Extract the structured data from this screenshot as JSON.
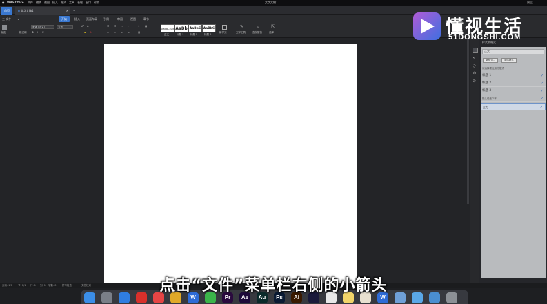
{
  "menubar": {
    "app_name": "WPS Office",
    "items": [
      "文件",
      "编辑",
      "视图",
      "插入",
      "格式",
      "工具",
      "表格",
      "窗口",
      "帮助"
    ],
    "window_title": "文字文稿1",
    "right_text": "周三"
  },
  "tabs": {
    "home_label": "首页",
    "doc_label": "文字文稿1",
    "add_icon": "plus-icon",
    "close_icon": "close-icon"
  },
  "ribbon": {
    "file_menu": "三 文件",
    "tabs": [
      "开始",
      "插入",
      "页面布局",
      "引用",
      "审阅",
      "视图",
      "章节"
    ],
    "active_tab": "开始"
  },
  "toolbar": {
    "paste_label": "粘贴",
    "format_painter_label": "格式刷",
    "font_name": "宋体 (正文)",
    "font_size": "五号",
    "styles": [
      {
        "preview": "AaBbCcDd",
        "caption": "正文"
      },
      {
        "preview": "AaBb",
        "caption": "标题 1"
      },
      {
        "preview": "AaBbC",
        "caption": "标题 2"
      },
      {
        "preview": "AaBbC",
        "caption": "标题 3"
      }
    ],
    "new_style_label": "新样式",
    "text_tools_label": "文字工具",
    "find_replace_label": "查找替换",
    "select_label": "选择"
  },
  "panel": {
    "title": "样式和格式",
    "current_style": "正文",
    "new_style_btn": "新样式...",
    "clear_format_btn": "清除格式",
    "section_label": "请选择要应用的格式",
    "items": [
      {
        "label": "标题 1",
        "checked": true
      },
      {
        "label": "标题 2",
        "checked": true
      },
      {
        "label": "标题 3",
        "checked": true
      }
    ],
    "default_para_label": "默认段落字体",
    "body_label": "正文"
  },
  "statusbar": {
    "page": "页码: 1/1",
    "section": "节: 1/1",
    "line": "行: 1",
    "col": "列: 1",
    "words": "字数: 0",
    "spell": "拼写检查",
    "proof": "文档校对"
  },
  "subtitle": "点击“文件”菜单栏右侧的小箭头",
  "watermark": {
    "title": "懂视生活",
    "sub": "51DONGSHI.COM"
  },
  "dock": {
    "apps": [
      {
        "name": "finder-icon",
        "label": "",
        "color": "#3b8ee8"
      },
      {
        "name": "launchpad-icon",
        "label": "",
        "color": "#7a7f88"
      },
      {
        "name": "baidu-netdisk-icon",
        "label": "",
        "color": "#2f7de1"
      },
      {
        "name": "netease-music-icon",
        "label": "",
        "color": "#d8302b"
      },
      {
        "name": "music-icon",
        "label": "",
        "color": "#e64545"
      },
      {
        "name": "chrome-icon",
        "label": "",
        "color": "#e0a929"
      },
      {
        "name": "wps-icon",
        "label": "W",
        "color": "#2e6bd6"
      },
      {
        "name": "wechat-icon",
        "label": "",
        "color": "#3bb54a"
      },
      {
        "name": "premiere-icon",
        "label": "Pr",
        "color": "#2a0a3e"
      },
      {
        "name": "after-effects-icon",
        "label": "Ae",
        "color": "#1d0a3a"
      },
      {
        "name": "audition-icon",
        "label": "Au",
        "color": "#0a2a2a"
      },
      {
        "name": "photoshop-icon",
        "label": "Ps",
        "color": "#0a1a33"
      },
      {
        "name": "illustrator-icon",
        "label": "Ai",
        "color": "#3a1a00"
      },
      {
        "name": "media-encoder-icon",
        "label": "",
        "color": "#1a1a3a"
      },
      {
        "name": "papers-icon",
        "label": "",
        "color": "#e8e8e8"
      },
      {
        "name": "notes-icon",
        "label": "",
        "color": "#f1d469"
      },
      {
        "name": "photos-icon",
        "label": "",
        "color": "#e8e0d0"
      },
      {
        "name": "wps-doc-icon",
        "label": "W",
        "color": "#2e6bd6"
      },
      {
        "name": "preview-icon",
        "label": "",
        "color": "#6fa0d8"
      },
      {
        "name": "folder-icon",
        "label": "",
        "color": "#5aa8e8"
      },
      {
        "name": "downloads-icon",
        "label": "",
        "color": "#4a8ed0"
      },
      {
        "name": "trash-icon",
        "label": "",
        "color": "#8c9096"
      }
    ]
  }
}
